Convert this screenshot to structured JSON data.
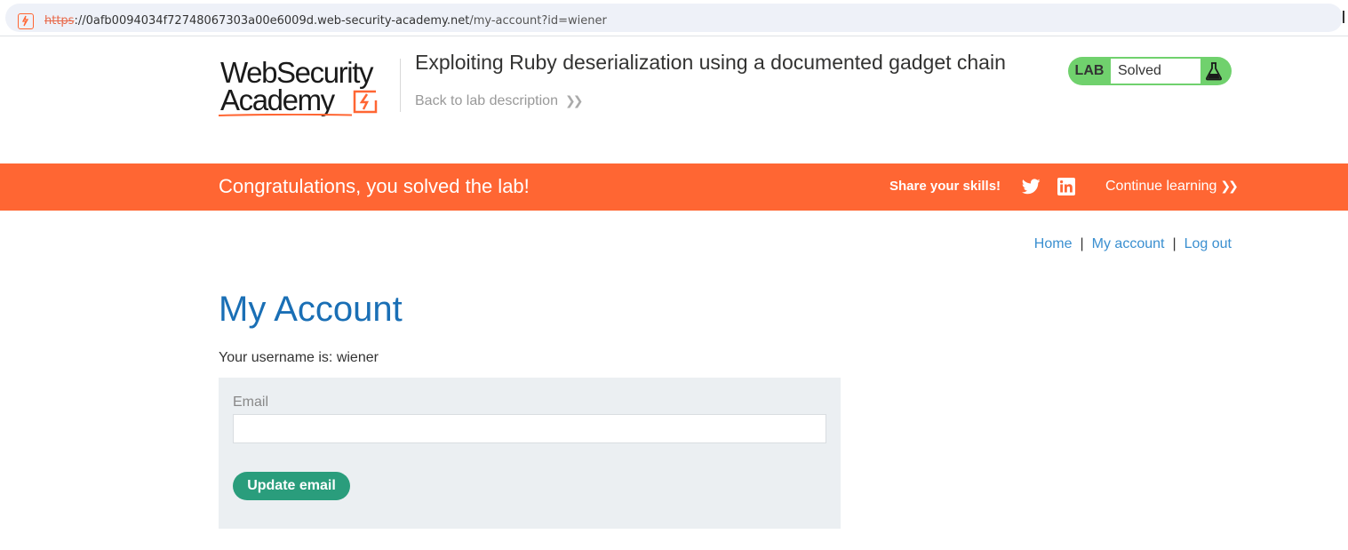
{
  "browser": {
    "url_scheme": "https",
    "url_host": "://0afb0094034f72748067303a00e6009d.web-security-academy.net",
    "url_path": "/my-account?id=wiener"
  },
  "header": {
    "logo_line1": "WebSecurity",
    "logo_line2": "Academy",
    "lab_title": "Exploiting Ruby deserialization using a documented gadget chain",
    "back_link": "Back to lab description",
    "lab_tag": "LAB",
    "lab_status": "Solved"
  },
  "banner": {
    "congrats": "Congratulations, you solved the lab!",
    "share": "Share your skills!",
    "continue": "Continue learning",
    "background_color": "#ff6633"
  },
  "nav": {
    "home": "Home",
    "separator": "|",
    "my_account": "My account",
    "logout": "Log out"
  },
  "main": {
    "title": "My Account",
    "username_line": "Your username is: wiener",
    "email_label": "Email",
    "email_value": "",
    "update_button": "Update email"
  },
  "colors": {
    "accent_orange": "#ff6633",
    "lab_green": "#70d16d",
    "title_blue": "#1a6fb5",
    "link_blue": "#3a8fd0",
    "button_teal": "#2a9d7c",
    "form_bg": "#ebeff2"
  },
  "icons": {
    "site": "lightning-bolt-icon",
    "back": "double-chevron-right-icon",
    "flask": "flask-icon",
    "twitter": "twitter-icon",
    "linkedin": "linkedin-icon"
  }
}
